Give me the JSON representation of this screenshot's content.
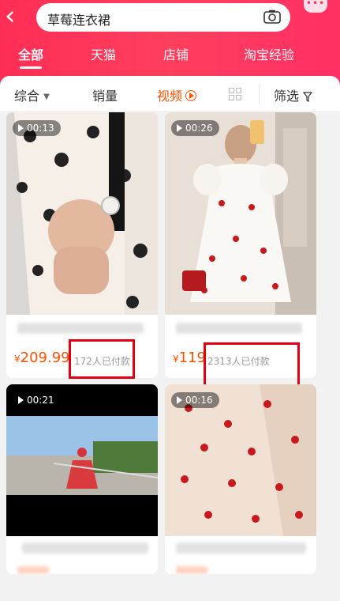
{
  "header": {
    "search_text": "草莓连衣裙",
    "tabs": [
      "全部",
      "天猫",
      "店铺",
      "淘宝经验"
    ],
    "more_label": "•••"
  },
  "filters": {
    "sort": "综合",
    "sales": "销量",
    "video": "视频",
    "filter": "筛选"
  },
  "products": [
    {
      "duration": "00:13",
      "price": "209.99",
      "sales": "172人已付款"
    },
    {
      "duration": "00:26",
      "price": "119",
      "sales": "2313人已付款"
    },
    {
      "duration": "00:21",
      "price": "",
      "sales": ""
    },
    {
      "duration": "00:16",
      "price": "",
      "sales": ""
    }
  ],
  "currency": "¥",
  "colors": {
    "brand": "#ff2d55",
    "price": "#ff5000",
    "highlight": "#e60012"
  }
}
